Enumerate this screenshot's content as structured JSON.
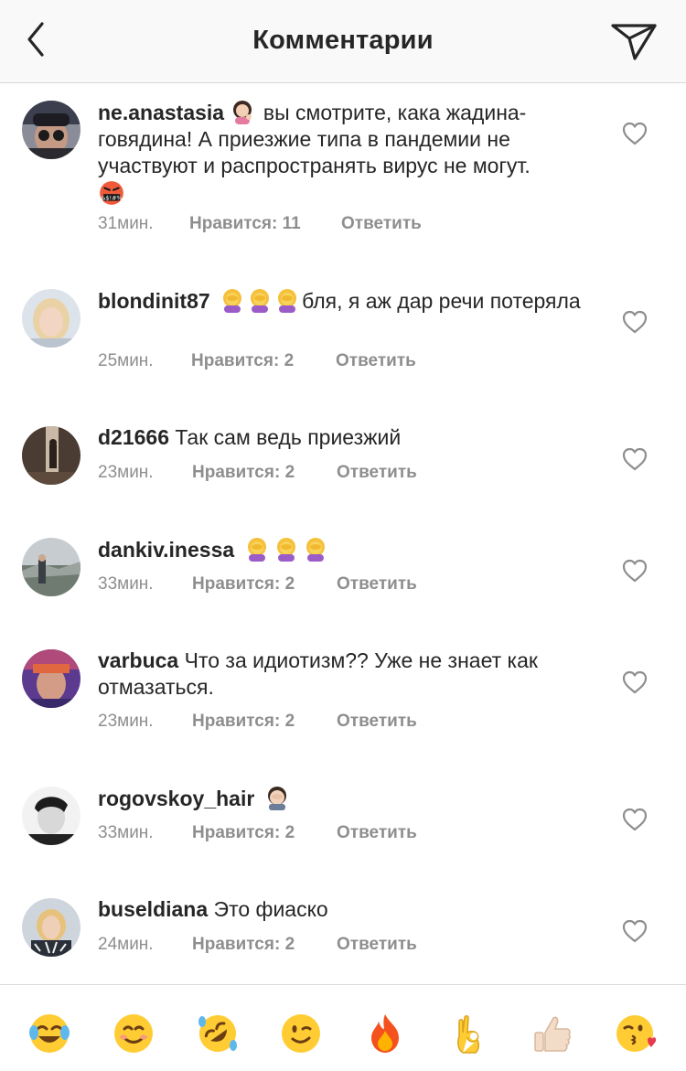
{
  "header": {
    "title": "Комментарии"
  },
  "icons": {
    "back": "chevron-left-icon",
    "send": "paper-plane-icon",
    "like": "heart-outline-icon"
  },
  "comments": [
    {
      "username": "ne.anastasia",
      "emoji_prefix": [
        "woman-tipping-hand"
      ],
      "text": " вы смотрите, кака жадина-говядина! А приезжие типа в пандемии не участвуют и распространять вирус не могут.",
      "emoji_suffix": [
        "face-with-symbols-on-mouth"
      ],
      "time": "31мин.",
      "likes": "Нравится: 11",
      "reply": "Ответить"
    },
    {
      "username": "blondinit87",
      "emoji_prefix": [
        "woman-facepalming",
        "woman-facepalming",
        "woman-facepalming"
      ],
      "text": "бля, я аж дар речи потеряла",
      "time": "25мин.",
      "likes": "Нравится: 2",
      "reply": "Ответить"
    },
    {
      "username": "d21666",
      "text": "Так сам ведь приезжий",
      "time": "23мин.",
      "likes": "Нравится: 2",
      "reply": "Ответить"
    },
    {
      "username": "dankiv.inessa",
      "emoji_prefix": [
        "woman-facepalming",
        "woman-facepalming",
        "woman-facepalming"
      ],
      "text": "",
      "time": "33мин.",
      "likes": "Нравится: 2",
      "reply": "Ответить"
    },
    {
      "username": "varbuca",
      "text": "Что за идиотизм?? Уже не знает как отмазаться.",
      "time": "23мин.",
      "likes": "Нравится: 2",
      "reply": "Ответить"
    },
    {
      "username": "rogovskoy_hair",
      "emoji_prefix": [
        "man-facepalming"
      ],
      "text": "",
      "time": "33мин.",
      "likes": "Нравится: 2",
      "reply": "Ответить"
    },
    {
      "username": "buseldiana",
      "text": "Это фиаско",
      "time": "24мин.",
      "likes": "Нравится: 2",
      "reply": "Ответить"
    }
  ],
  "emoji_bar": [
    "face-with-tears-of-joy",
    "smiling-face",
    "rolling-on-floor-laughing",
    "winking-face",
    "fire",
    "ok-hand",
    "thumbs-up",
    "face-blowing-kiss"
  ],
  "colors": {
    "text": "#262626",
    "secondary": "#8e8e8e",
    "header_bg": "#f9f9f9",
    "divider": "#dbdbdb",
    "emoji_yellow": "#ffcc33",
    "fire": "#f4511e"
  }
}
